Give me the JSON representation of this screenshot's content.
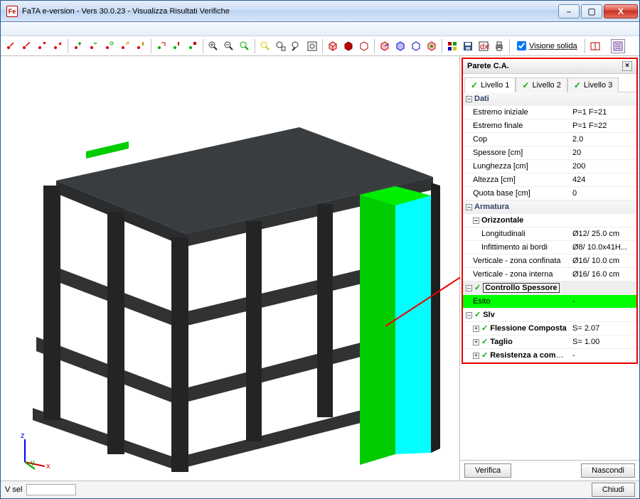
{
  "window": {
    "title": "FaTA e-version - Vers 30.0.23 - Visualizza Risultati Verifiche",
    "icon": "Fe"
  },
  "winbtns": {
    "min": "–",
    "max": "▢",
    "close": "X"
  },
  "toolbar": {
    "solid_label": "Visione solida"
  },
  "panel": {
    "title": "Parete C.A.",
    "tabs": [
      "Livello 1",
      "Livello 2",
      "Livello 3"
    ],
    "dati_label": "Dati",
    "rows": {
      "estremo_iniziale": {
        "k": "Estremo iniziale",
        "v": "P=1 F=21"
      },
      "estremo_finale": {
        "k": "Estremo finale",
        "v": "P=1 F=22"
      },
      "cop": {
        "k": "Cop",
        "v": "2.0"
      },
      "spessore": {
        "k": "Spessore [cm]",
        "v": "20"
      },
      "lunghezza": {
        "k": "Lunghezza [cm]",
        "v": "200"
      },
      "altezza": {
        "k": "Altezza [cm]",
        "v": "424"
      },
      "quota": {
        "k": "Quota base [cm]",
        "v": "0"
      }
    },
    "armatura_label": "Armatura",
    "orizz_label": "Orizzontale",
    "orizz": {
      "longitudinali": {
        "k": "Longitudinali",
        "v": "Ø12/ 25.0 cm"
      },
      "infittimento": {
        "k": "Infittimento ai bordi",
        "v": "Ø8/ 10.0x41H..."
      }
    },
    "vert_conf": {
      "k": "Verticale - zona confinata",
      "v": "Ø16/ 10.0 cm"
    },
    "vert_int": {
      "k": "Verticale - zona interna",
      "v": "Ø16/ 16.0 cm"
    },
    "ctrl_spess": "Controllo Spessore",
    "esito": {
      "k": "Esito",
      "v": "-"
    },
    "slv": "Slv",
    "flessione": {
      "k": "Flessione Composta",
      "v": "S= 2.07"
    },
    "taglio": {
      "k": "Taglio",
      "v": "S= 1.00"
    },
    "resist": {
      "k": "Resistenza a compr...",
      "v": "-"
    }
  },
  "buttons": {
    "verifica": "Verifica",
    "nascondi": "Nascondi",
    "chiudi": "Chiudi"
  },
  "status": {
    "vsel": "V sel"
  },
  "axis": {
    "x": "x",
    "y": "y",
    "z": "z"
  }
}
